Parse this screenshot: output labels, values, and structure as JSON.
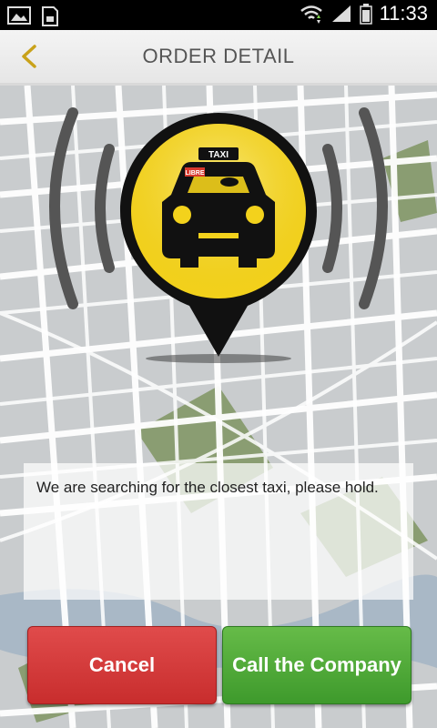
{
  "status_bar": {
    "time": "11:33",
    "icons": [
      "image-icon",
      "sd-card-icon",
      "wifi-icon",
      "signal-icon",
      "battery-icon"
    ]
  },
  "header": {
    "title": "ORDER DETAIL",
    "back_icon": "chevron-left-icon"
  },
  "marker": {
    "taxi_sign": "TAXI",
    "libre_sign": "LIBRE",
    "icon": "taxi-pin-icon"
  },
  "message": "We are searching for the closest taxi, please hold.",
  "buttons": {
    "cancel_label": "Cancel",
    "call_label": "Call the Company"
  },
  "colors": {
    "accent_yellow": "#f3d21c",
    "cancel_red": "#d63a3a",
    "call_green": "#52aa3a",
    "header_bg": "#eeeeee"
  }
}
